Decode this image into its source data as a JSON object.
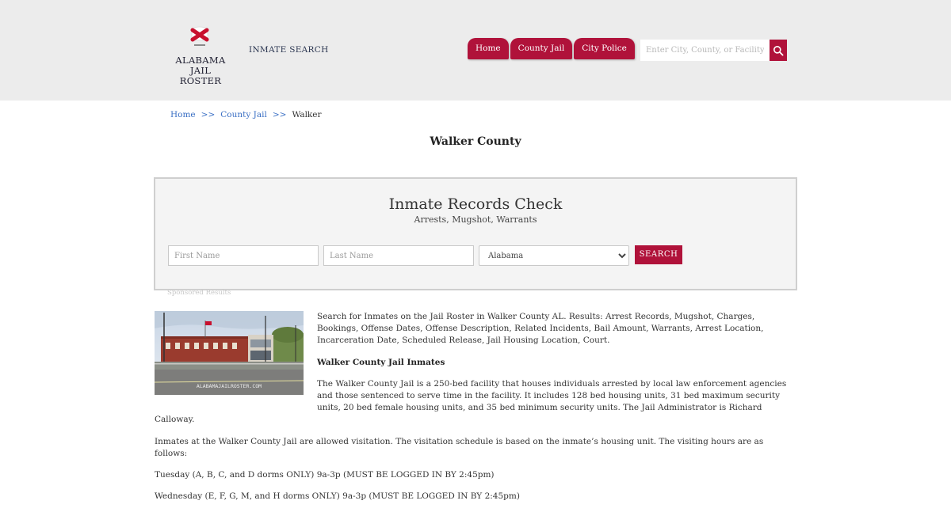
{
  "header": {
    "logo_line1": "ALABAMA",
    "logo_line2": "JAIL ROSTER",
    "inmate_search": "INMATE SEARCH",
    "nav": [
      "Home",
      "County Jail",
      "City Police"
    ],
    "search_placeholder": "Enter City, County, or Facility"
  },
  "breadcrumb": {
    "home": "Home",
    "sep": ">>",
    "county_jail": "County Jail",
    "current": "Walker"
  },
  "page_title": "Walker County",
  "records": {
    "title": "Inmate Records Check",
    "subtitle": "Arrests, Mugshot, Warrants",
    "first_placeholder": "First Name",
    "last_placeholder": "Last Name",
    "state_selected": "Alabama",
    "button": "SEARCH",
    "sponsored": "Sponsored Results"
  },
  "article": {
    "photo_watermark": "ALABAMAJAILROSTER.COM",
    "intro": "Search for Inmates on the Jail Roster in Walker  County AL. Results: Arrest Records, Mugshot, Charges, Bookings, Offense Dates, Offense Description, Related Incidents, Bail Amount, Warrants, Arrest Location, Incarceration Date, Scheduled Release, Jail Housing Location, Court.",
    "subheading": "Walker County Jail Inmates",
    "description": "The Walker County Jail is a 250-bed facility that houses individuals arrested by local law enforcement agencies and those sentenced to serve time in the facility. It includes 128 bed housing units, 31 bed maximum security units, 20 bed female housing units, and 35 bed minimum security units. The Jail Administrator is Richard Calloway.",
    "visitation": "Inmates at the Walker County Jail are allowed visitation. The visitation schedule is based on the inmate’s housing unit. The visiting hours are as follows:",
    "tuesday": "Tuesday (A, B, C, and D dorms ONLY) 9a-3p (MUST BE LOGGED IN BY 2:45pm)",
    "wednesday": "Wednesday (E, F, G, M, and H dorms ONLY) 9a-3p (MUST BE LOGGED IN BY 2:45pm)"
  },
  "colors": {
    "accent": "#b0123a",
    "header_bg": "#ececec",
    "link": "#3a6fc4"
  }
}
